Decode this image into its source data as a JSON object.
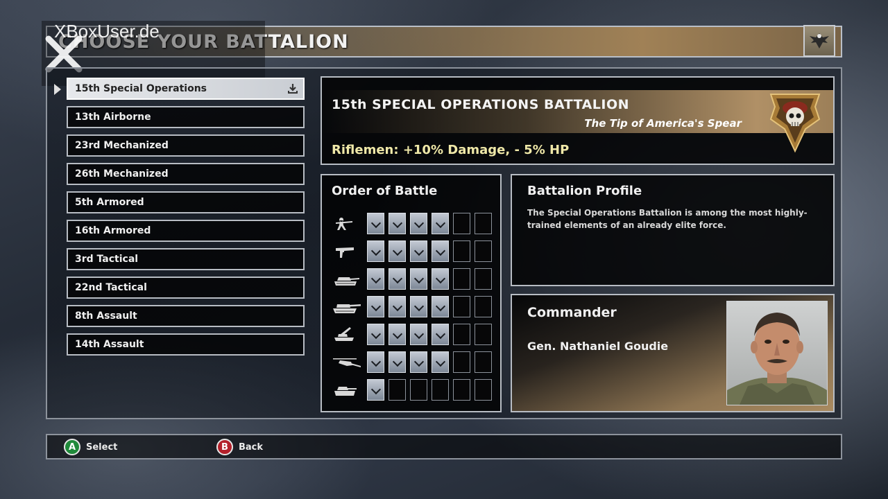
{
  "header": {
    "title": "CHOOSE YOUR BATTALION"
  },
  "watermark": {
    "text": "XBoxUser.de"
  },
  "battalions": [
    {
      "label": "15th Special Operations",
      "selected": true
    },
    {
      "label": "13th Airborne"
    },
    {
      "label": "23rd Mechanized"
    },
    {
      "label": "26th Mechanized"
    },
    {
      "label": "5th Armored"
    },
    {
      "label": "16th Armored"
    },
    {
      "label": "3rd Tactical"
    },
    {
      "label": "22nd Tactical"
    },
    {
      "label": "8th Assault"
    },
    {
      "label": "14th Assault"
    }
  ],
  "selected_battalion": {
    "name": "15th SPECIAL OPERATIONS BATTALION",
    "motto": "The Tip of America's Spear",
    "bonus": "Riflemen: +10% Damage, - 5% HP"
  },
  "order_of_battle": {
    "title": "Order of Battle",
    "slots_per_row": 6,
    "units": [
      {
        "icon": "rifleman-icon",
        "filled": 4
      },
      {
        "icon": "machine-gunner-icon",
        "filled": 4
      },
      {
        "icon": "light-tank-icon",
        "filled": 4
      },
      {
        "icon": "heavy-tank-icon",
        "filled": 4
      },
      {
        "icon": "artillery-icon",
        "filled": 4
      },
      {
        "icon": "helicopter-icon",
        "filled": 4
      },
      {
        "icon": "special-vehicle-icon",
        "filled": 1
      }
    ]
  },
  "profile": {
    "title": "Battalion Profile",
    "text": "The Special Operations Battalion is among the most highly-trained elements of an already elite force."
  },
  "commander": {
    "title": "Commander",
    "name": "Gen. Nathaniel Goudie"
  },
  "controls": {
    "select": {
      "button": "A",
      "label": "Select",
      "color": "#1f8a3a"
    },
    "back": {
      "button": "B",
      "label": "Back",
      "color": "#b3202a"
    }
  }
}
